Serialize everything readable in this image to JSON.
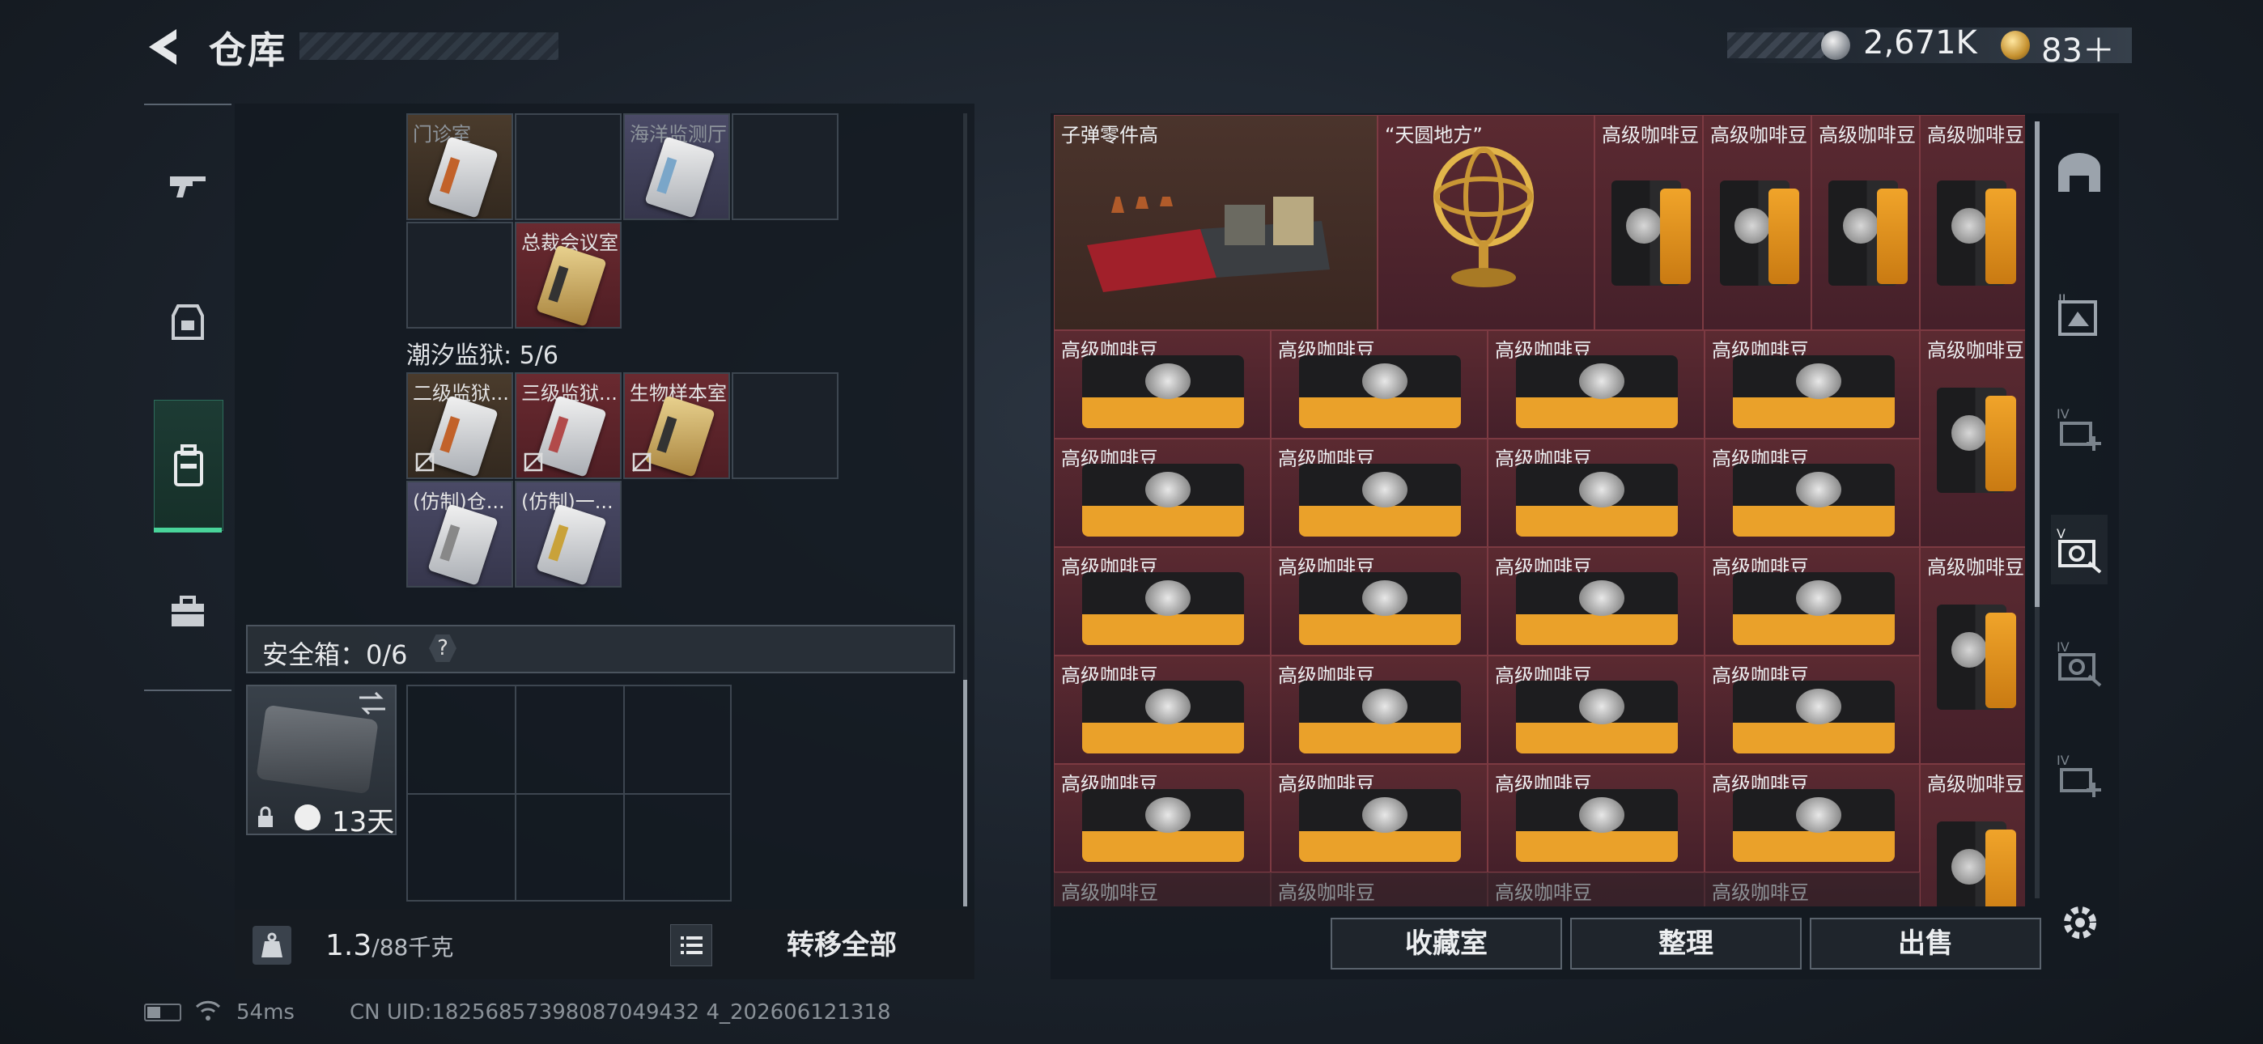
{
  "header": {
    "title": "仓库"
  },
  "currency": {
    "silver": "2,671K",
    "gold": "83＋"
  },
  "left_panel": {
    "items_row1": [
      {
        "label": "门诊室",
        "dim": true
      },
      {
        "label": "",
        "dim": false
      },
      {
        "label": "海洋监测厅",
        "dim": true
      }
    ],
    "items_row2": [
      {
        "label": "总裁会议室"
      }
    ],
    "section2_label": "潮汐监狱: 5/6",
    "items_row3": [
      {
        "label": "二级监狱..."
      },
      {
        "label": "三级监狱..."
      },
      {
        "label": "生物样本室"
      }
    ],
    "items_row4": [
      {
        "label": "(仿制)仓..."
      },
      {
        "label": "(仿制)一..."
      }
    ],
    "secure_box_label": "安全箱：0/6",
    "help": "?",
    "case_days": "13天",
    "weight_current": "1.3",
    "weight_total": "/88千克",
    "transfer_all": "转移全部"
  },
  "right_panel": {
    "top_row": [
      {
        "label": "子弹零件高"
      },
      {
        "label": "“天圆地方”"
      },
      {
        "label": "高级咖啡豆"
      },
      {
        "label": "高级咖啡豆"
      },
      {
        "label": "高级咖啡豆"
      },
      {
        "label": "高级咖啡豆"
      }
    ],
    "coffee_label": "高级咖啡豆",
    "buttons": {
      "collection": "收藏室",
      "sort": "整理",
      "sell": "出售"
    }
  },
  "footer": {
    "ping": "54ms",
    "uid": "CN UID:18256857398087049432 4_202606121318"
  },
  "colors": {
    "accent": "#49d49a",
    "item_red": "#5b2a31",
    "panel": "#141a21"
  }
}
